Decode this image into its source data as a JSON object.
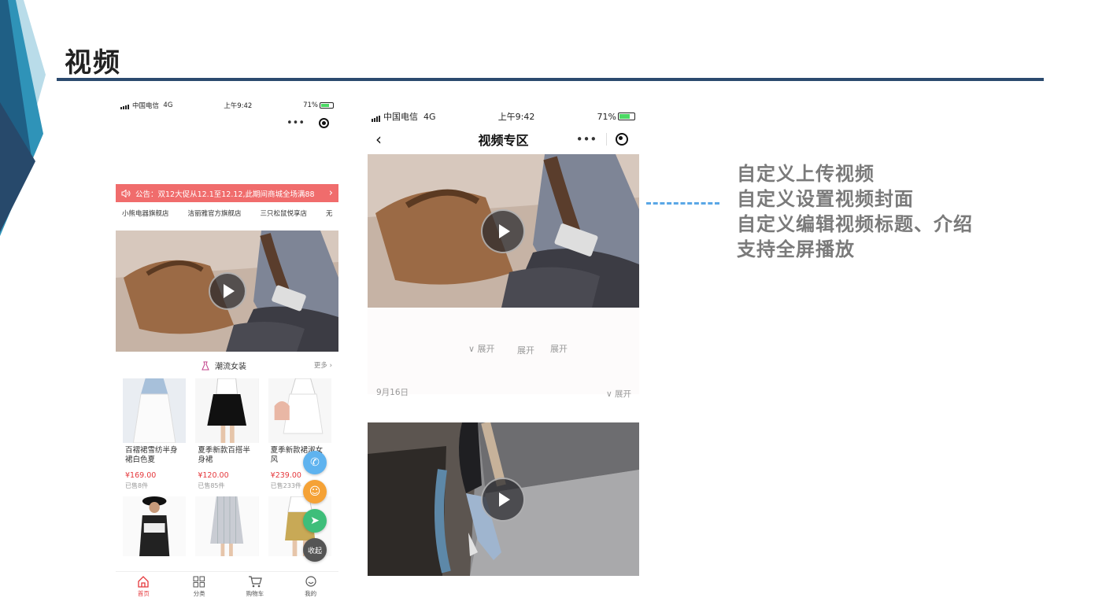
{
  "slide": {
    "title": "视频",
    "features": [
      "自定义上传视频",
      "自定义设置视频封面",
      "自定义编辑视频标题、介绍",
      "支持全屏播放"
    ]
  },
  "phone_home": {
    "status": {
      "carrier": "中国电信",
      "network": "4G",
      "time": "上午9:42",
      "battery": "71%"
    },
    "capsule": {
      "more": "•••"
    },
    "notice": "公告：双12大促从12.1至12.12,此期间商城全场满88",
    "notice_arrow": "›",
    "shops": [
      "小熊电器旗舰店",
      "洁丽雅官方旗舰店",
      "三只松鼠悦享店",
      "无"
    ],
    "category": {
      "title": "潮流女装",
      "more": "更多 ›"
    },
    "products": [
      {
        "name": "百褶裙雪纺半身裙白色夏",
        "price": "¥169.00",
        "sold": "已售8件"
      },
      {
        "name": "夏季新款百搭半身裙",
        "price": "¥120.00",
        "sold": "已售85件"
      },
      {
        "name": "夏季新款裙淑女风",
        "price": "¥239.00",
        "sold": "已售233件"
      }
    ],
    "float_buttons": {
      "phone": "✆",
      "chat": "☺",
      "share": "➤",
      "collapse": "收起"
    },
    "tabs": [
      {
        "label": "首页",
        "icon": "home-icon"
      },
      {
        "label": "分类",
        "icon": "grid-icon"
      },
      {
        "label": "购物车",
        "icon": "cart-icon"
      },
      {
        "label": "我的",
        "icon": "user-icon"
      }
    ]
  },
  "phone_video": {
    "status": {
      "carrier": "中国电信",
      "network": "4G",
      "time": "上午9:42",
      "battery": "71%"
    },
    "nav": {
      "back": "‹",
      "title": "视频专区",
      "more": "•••"
    },
    "expand_labels": [
      "∨ 展开",
      "展开",
      "展开"
    ],
    "date": "9月16日",
    "date_expand": "∨ 展开"
  },
  "colors": {
    "title_rule": "#2b4a6e",
    "notice_bg": "#f06c6c",
    "price": "#e5383c",
    "feature_text": "#7a7a7a",
    "connector": "#5aa7e6"
  }
}
